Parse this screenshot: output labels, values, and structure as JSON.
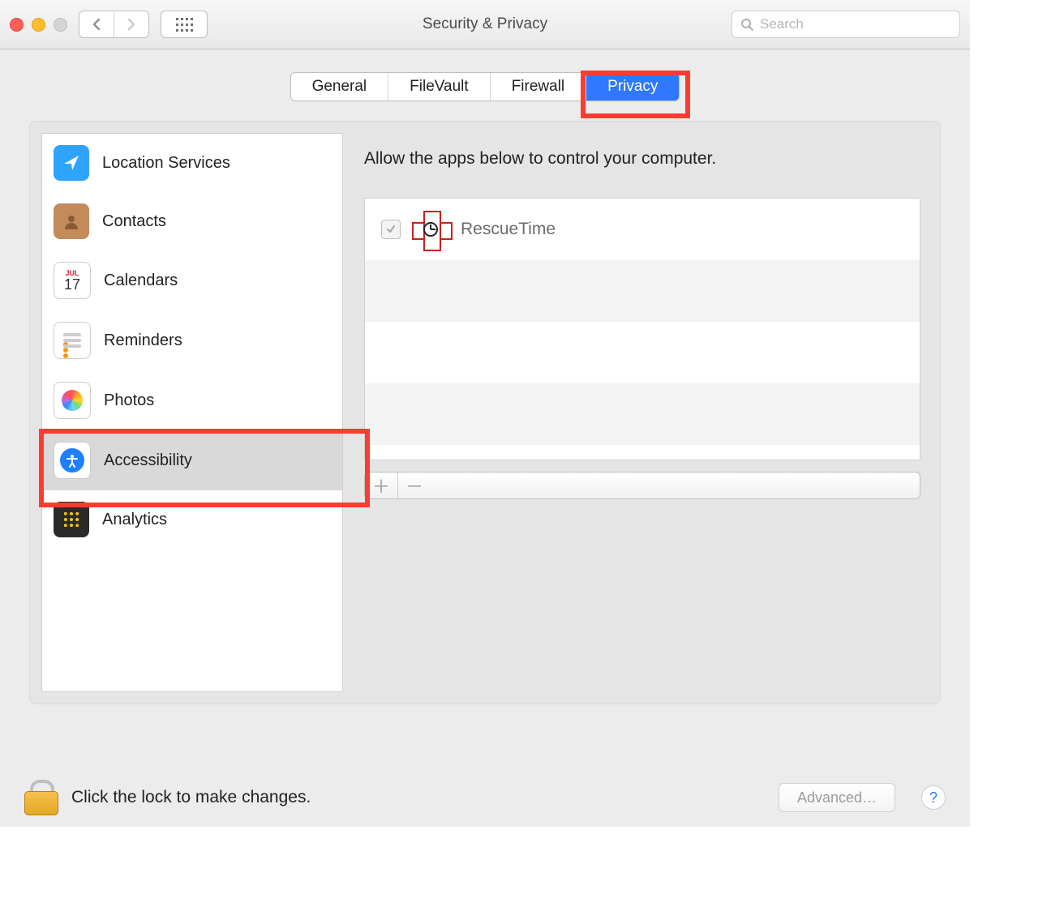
{
  "title": "Security & Privacy",
  "search": {
    "placeholder": "Search"
  },
  "tabs": [
    {
      "label": "General",
      "active": false
    },
    {
      "label": "FileVault",
      "active": false
    },
    {
      "label": "Firewall",
      "active": false
    },
    {
      "label": "Privacy",
      "active": true
    }
  ],
  "sidebar": {
    "items": [
      {
        "label": "Location Services",
        "icon": "location-icon"
      },
      {
        "label": "Contacts",
        "icon": "contacts-icon"
      },
      {
        "label": "Calendars",
        "icon": "calendar-icon",
        "cal_month": "JUL",
        "cal_day": "17"
      },
      {
        "label": "Reminders",
        "icon": "reminders-icon"
      },
      {
        "label": "Photos",
        "icon": "photos-icon"
      },
      {
        "label": "Accessibility",
        "icon": "accessibility-icon",
        "selected": true
      },
      {
        "label": "Analytics",
        "icon": "analytics-icon"
      }
    ]
  },
  "content": {
    "heading": "Allow the apps below to control your computer.",
    "apps": [
      {
        "name": "RescueTime",
        "checked": true
      }
    ]
  },
  "footer": {
    "lock_text": "Click the lock to make changes.",
    "advanced_label": "Advanced…",
    "help_label": "?"
  }
}
